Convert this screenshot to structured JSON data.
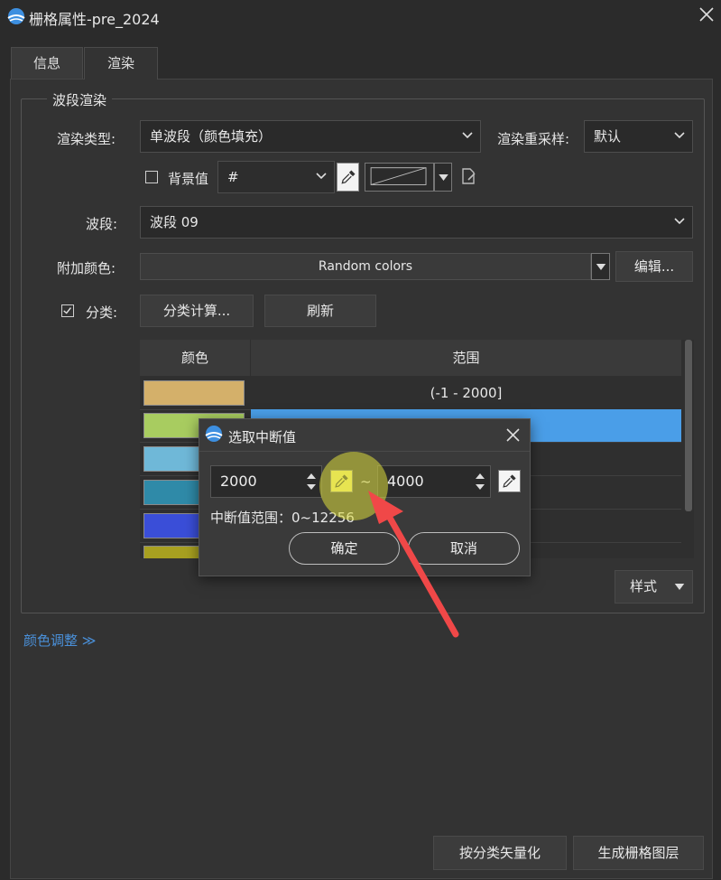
{
  "window": {
    "title": "栅格属性-pre_2024"
  },
  "tabs": [
    {
      "label": "信息"
    },
    {
      "label": "渲染"
    }
  ],
  "group": {
    "title": "波段渲染"
  },
  "render_type": {
    "label": "渲染类型:",
    "value": "单波段（颜色填充）"
  },
  "resample": {
    "label": "渲染重采样:",
    "value": "默认"
  },
  "background": {
    "label": "背景值",
    "value": "#"
  },
  "band": {
    "label": "波段:",
    "value": "波段 09"
  },
  "extra_color": {
    "label": "附加颜色:",
    "value": "Random colors",
    "edit_button": "编辑..."
  },
  "classify": {
    "label": "分类:",
    "calc_button": "分类计算...",
    "refresh_button": "刷新"
  },
  "table": {
    "headers": [
      "颜色",
      "范围"
    ],
    "rows": [
      {
        "color": "#d4b06a",
        "range": "(-1 - 2000]"
      },
      {
        "color": "#a8cc60",
        "range": ""
      },
      {
        "color": "#6fb8d8",
        "range": ""
      },
      {
        "color": "#2f8aa8",
        "range": ""
      },
      {
        "color": "#3a4ed8",
        "range": ""
      },
      {
        "color": "#a8a020",
        "range": ""
      }
    ]
  },
  "style_button": "样式",
  "color_adjust_link": "颜色调整 ≫",
  "footer": {
    "vectorize_button": "按分类矢量化",
    "generate_button": "生成栅格图层"
  },
  "dialog": {
    "title": "选取中断值",
    "from_value": "2000",
    "tilde": "~",
    "to_value": "4000",
    "range_text": "中断值范围：0~12256",
    "ok_button": "确定",
    "cancel_button": "取消"
  },
  "colors": {
    "selection": "#4a9ee8",
    "accent_link": "#4a90d9",
    "annotation_arrow": "#f04848"
  }
}
